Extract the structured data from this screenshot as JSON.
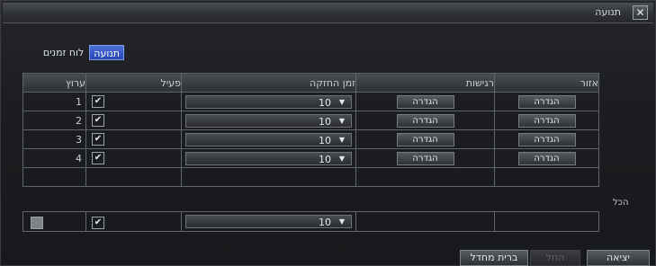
{
  "window": {
    "title": "תנועה"
  },
  "tabs": [
    {
      "label": "תנועה",
      "active": true
    },
    {
      "label": "לוח זמנים",
      "active": false
    }
  ],
  "table": {
    "headers": [
      "אזור",
      "רגישות",
      "זמן החזקה",
      "פעיל",
      "ערוץ"
    ],
    "rows": [
      {
        "channel": "1",
        "hold_value": "10",
        "enabled": true,
        "area_btn": "הגדרה",
        "sens_btn": "הגדרה"
      },
      {
        "channel": "2",
        "hold_value": "10",
        "enabled": true,
        "area_btn": "הגדרה",
        "sens_btn": "הגדרה"
      },
      {
        "channel": "3",
        "hold_value": "10",
        "enabled": true,
        "area_btn": "הגדרה",
        "sens_btn": "הגדרה"
      },
      {
        "channel": "4",
        "hold_value": "10",
        "enabled": true,
        "area_btn": "הגדרה",
        "sens_btn": "הגדרה"
      }
    ]
  },
  "all_section": {
    "label": "הכל",
    "hold_value": "10",
    "enabled": true,
    "selected": false
  },
  "footer": {
    "default_label": "ברית מחדל",
    "apply_label": "החל",
    "exit_label": "יציאה"
  },
  "icons": {
    "close": "close-icon",
    "dropdown": "chevron-down-icon",
    "check": "checkmark-icon"
  },
  "colors": {
    "active_tab": "#2846b3",
    "background": "#18191c"
  }
}
